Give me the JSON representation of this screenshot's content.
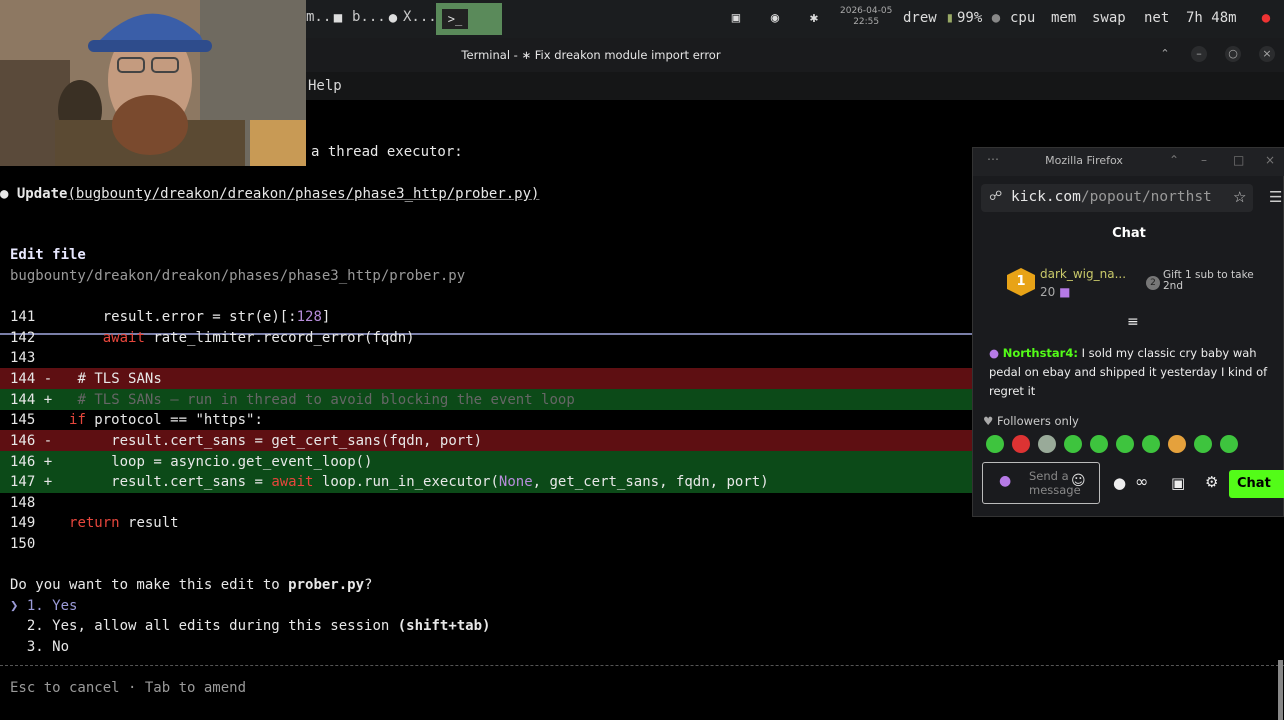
{
  "taskbar": {
    "tasks": [
      "m..",
      "b...",
      "X..."
    ],
    "clock": {
      "date": "2026-04-05",
      "time": "22:55"
    },
    "user": "drew",
    "battery": "99%",
    "meters": [
      "cpu",
      "mem",
      "swap",
      "net"
    ],
    "uptime": "7h 48m"
  },
  "window": {
    "title": "Terminal - ∗ Fix dreakon module import error"
  },
  "menu": {
    "help": "Help"
  },
  "terminal": {
    "context_line": "a thread executor:",
    "update_bullet": "●",
    "update_label": "Update",
    "update_path": "(bugbounty/dreakon/dreakon/phases/phase3_http/prober.py)",
    "edit_header": "Edit file",
    "edit_path": "bugbounty/dreakon/dreakon/phases/phase3_http/prober.py",
    "diff": [
      {
        "num": "141",
        "sign": " ",
        "code": "        result.error = str(e)[:128]"
      },
      {
        "num": "142",
        "sign": " ",
        "code": "        await rate_limiter.record_error(fqdn)"
      },
      {
        "num": "143",
        "sign": " ",
        "code": ""
      },
      {
        "num": "144",
        "sign": "-",
        "code": "    # TLS SANs"
      },
      {
        "num": "144",
        "sign": "+",
        "code": "    # TLS SANs — run in thread to avoid blocking the event loop"
      },
      {
        "num": "145",
        "sign": " ",
        "code": "    if protocol == \"https\":"
      },
      {
        "num": "146",
        "sign": "-",
        "code": "        result.cert_sans = get_cert_sans(fqdn, port)"
      },
      {
        "num": "146",
        "sign": "+",
        "code": "        loop = asyncio.get_event_loop()"
      },
      {
        "num": "147",
        "sign": "+",
        "code": "        result.cert_sans = await loop.run_in_executor(None, get_cert_sans, fqdn, port)"
      },
      {
        "num": "148",
        "sign": " ",
        "code": ""
      },
      {
        "num": "149",
        "sign": " ",
        "code": "    return result"
      },
      {
        "num": "150",
        "sign": " ",
        "code": ""
      }
    ],
    "prompt_question_pre": "Do you want to make this edit to ",
    "prompt_file": "prober.py",
    "prompt_question_post": "?",
    "options": [
      {
        "marker": "❯",
        "num": "1.",
        "label": "Yes"
      },
      {
        "marker": " ",
        "num": "2.",
        "label": "Yes, allow all edits during this session",
        "hint": "(shift+tab)"
      },
      {
        "marker": " ",
        "num": "3.",
        "label": "No"
      }
    ],
    "footer": "Esc to cancel · Tab to amend"
  },
  "firefox": {
    "title": "Mozilla Firefox",
    "url_host": "kick.com",
    "url_rest": "/popout/northst",
    "chat_title": "Chat",
    "top_gifter": {
      "name": "dark_wig_na...",
      "count": "20",
      "rank": "1"
    },
    "gift_hint": "Gift 1 sub to take 2nd",
    "message": {
      "user": "Northstar4:",
      "text": "I sold my classic cry baby wah pedal on ebay and shipped it yesterday I kind of regret it"
    },
    "followers_only": "Followers only",
    "send_placeholder": "Send a message",
    "chat_button": "Chat"
  },
  "colors": {
    "added": "#0c4a18",
    "removed": "#5e0f12",
    "keyword": "#e6463c",
    "accent_green": "#53fc18"
  }
}
